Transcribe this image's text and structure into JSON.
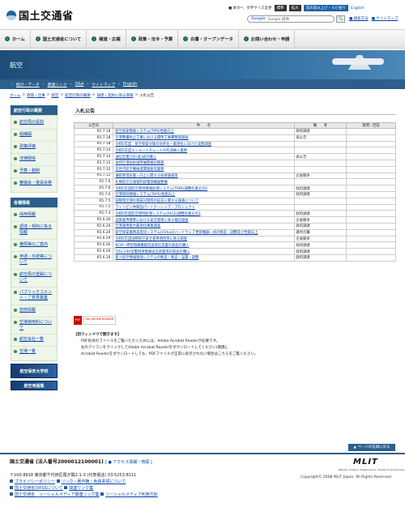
{
  "header": {
    "logo_text": "国土交通省",
    "utility": {
      "text_version": "■ 本文へ",
      "font_size_label": "文字サイズ変更",
      "standard": "標準",
      "large": "拡大",
      "radio": "音声読み上げ・ルビ振り",
      "english": "English"
    },
    "search": {
      "placeholder": "Google 提供",
      "google": "Google",
      "button": "🔍"
    },
    "links": [
      "■ 検索方法",
      "■ サイトマップ"
    ]
  },
  "nav": [
    "ホーム",
    "国土交通省について",
    "報道・広報",
    "政策・法令・予算",
    "白書・オープンデータ",
    "お問い合わせ・申請"
  ],
  "banner": {
    "title": "航空"
  },
  "subnav": [
    "統計・データ",
    "関連リンク",
    "Q&A",
    "サイトマップ",
    "English"
  ],
  "breadcrumb": [
    "ホーム",
    "政策・仕事",
    "航空",
    "航空行政の概要",
    "調達・契約に係る情報",
    "入札公告"
  ],
  "sidebar": {
    "section1_title": "航空行政の概要",
    "section1_items": [
      "航空局の役割",
      "組織図",
      "政策評価",
      "法律関係",
      "予算・税制",
      "審議会・委員会等"
    ],
    "section2_title": "各種情報",
    "section2_items": [
      "採用情報",
      "調達・契約に係る情報",
      "権限等のご案内",
      "申請・手続等について",
      "航空局の登録について",
      "パブリックコメント・ご意見募集",
      "技術情報",
      "空港使用料について",
      "航空会社一覧",
      "空港一覧"
    ],
    "banner1": "航空保安大学校",
    "banner2": "航空用語集"
  },
  "main": {
    "title": "入札公告",
    "headers": [
      "公告日",
      "件　　名",
      "備　　考",
      "質問・回答"
    ],
    "rows": [
      {
        "date": "R5.7.18",
        "name": "航空保安無線システム(TIPS)性能向上",
        "note": "政府調達",
        "qa": ""
      },
      {
        "date": "R5.7.18",
        "name": "空港整備防止工事における標準工事費整理調査",
        "note": "再公告",
        "qa": ""
      },
      {
        "date": "R5.7.18",
        "name": "令和5年度　航空保安対策の効率化・最適化に向けた実態調査",
        "note": "",
        "qa": ""
      },
      {
        "date": "R5.7.14",
        "name": "令和5年度エンルートチャートの作成納入業務",
        "note": "",
        "qa": ""
      },
      {
        "date": "R5.7.14",
        "name": "通信型電力計(高)式の購入",
        "note": "再公告",
        "qa": ""
      },
      {
        "date": "R5.7.13",
        "name": "本邦空港技術国際展開検討調査",
        "note": "",
        "qa": ""
      },
      {
        "date": "R5.7.12",
        "name": "次世代航空機推進関連委託業務",
        "note": "",
        "qa": ""
      },
      {
        "date": "R5.7.12",
        "name": "運航管理支援・向上に関する技術調査等",
        "note": "企画競争",
        "qa": ""
      },
      {
        "date": "R5.7.6",
        "name": "札幌航空交通管制部電源機器整備",
        "note": "",
        "qa": ""
      },
      {
        "date": "R5.7.6",
        "name": "令和5年度航空管制情報処理システム(TAPS)調整作業その2",
        "note": "政府調達",
        "qa": ""
      },
      {
        "date": "R5.7.6",
        "name": "空港管制情報システム(TAPS)性能向上",
        "note": "政府調達",
        "qa": ""
      },
      {
        "date": "R5.7.5",
        "name": "国管理空港の保安対策等の拡充に関する調査について",
        "note": "",
        "qa": ""
      },
      {
        "date": "R5.7.5",
        "name": "フィリピン共和国パートナーシップ・プロジェクト",
        "note": "",
        "qa": ""
      },
      {
        "date": "R5.7.4",
        "name": "令和5年度航空管制処理システム(FACE)調整作業その2",
        "note": "政府調達",
        "qa": ""
      },
      {
        "date": "R5.6.30",
        "name": "成果業界標準における安全管理に係る検討調査",
        "note": "企画競争",
        "qa": ""
      },
      {
        "date": "R5.6.29",
        "name": "空港運用能力最適化事業調査",
        "note": "政府調達",
        "qa": ""
      },
      {
        "date": "R5.6.29",
        "name": "航空保安業務高度化システム(Virtual)ハードウェア更新機器一式の製造・調整及び性能向上",
        "note": "著見召募",
        "qa": ""
      },
      {
        "date": "R5.6.29",
        "name": "令和5年度国際航空安全基準適用等に係る調査",
        "note": "企画競争",
        "qa": ""
      },
      {
        "date": "R5.6.26",
        "name": "RCM一押型無線機能別送受信装置の部品の購入",
        "note": "政府調達",
        "qa": ""
      },
      {
        "date": "R5.6.26",
        "name": "TDU-14A型電制用無線送信装置等の部品の購入",
        "note": "政府調達",
        "qa": ""
      },
      {
        "date": "R5.6.19",
        "name": "新入航空情報管理システムの製造・製造・設置・調整",
        "note": "政府調達",
        "qa": ""
      }
    ],
    "pdf_icon": "PDF",
    "pdf_badge": "Get ADOBE READER",
    "notes_heading": "【別ウィンドウで開きます】",
    "notes": [
      "PDF形式のファイルをご覧いただくためには、Adobe Acrobat Readerが必要です。",
      "左のアイコンをクリックしてAdobe Acrobat Readerをダウンロードしてください(無償)。",
      "Acrobat Readerをダウンロードしても、PDFファイルが正常に表示されない場合はこちらをご覧ください。"
    ]
  },
  "footer": {
    "pagetop": "▲ ページの先頭に戻る",
    "org": "国土交通省 (法人番号2000012100001)",
    "access": "[ ● アクセス情報・地図 ]",
    "address": "〒100-8918 東京都千代田区霞が関2-1-3 (代表電話) 03-5253-8111",
    "links": [
      [
        "プライバシーポリシー",
        "リンク・著作権・免責事項について"
      ],
      [
        "国土交通省のRSSについて",
        "関連リンク集"
      ],
      [
        "国土交通省　ソーシャルメディア関連リンク集",
        "ソーシャルメディア利用方針"
      ]
    ],
    "mlit": "MLIT",
    "mlit_sub": "Ministry of Land, Infrastructure, Transport and Tourism",
    "copyright": "Copyright© 2008 MLIT Japan. All Rights Reserved."
  }
}
